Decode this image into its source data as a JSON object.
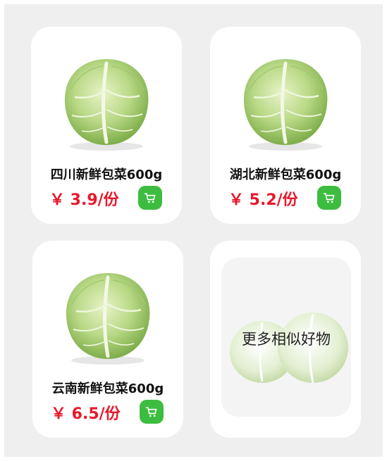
{
  "products": [
    {
      "name": "四川新鲜包菜600g",
      "price": "￥ 3.9/份"
    },
    {
      "name": "湖北新鲜包菜600g",
      "price": "￥ 5.2/份"
    },
    {
      "name": "云南新鲜包菜600g",
      "price": "￥ 6.5/份"
    }
  ],
  "more": {
    "label": "更多相似好物"
  },
  "colors": {
    "price": "#e8182b",
    "cart": "#3dbd3f",
    "background": "#efefef"
  },
  "icons": {
    "cart": "cart-icon",
    "product_image": "cabbage-image"
  }
}
